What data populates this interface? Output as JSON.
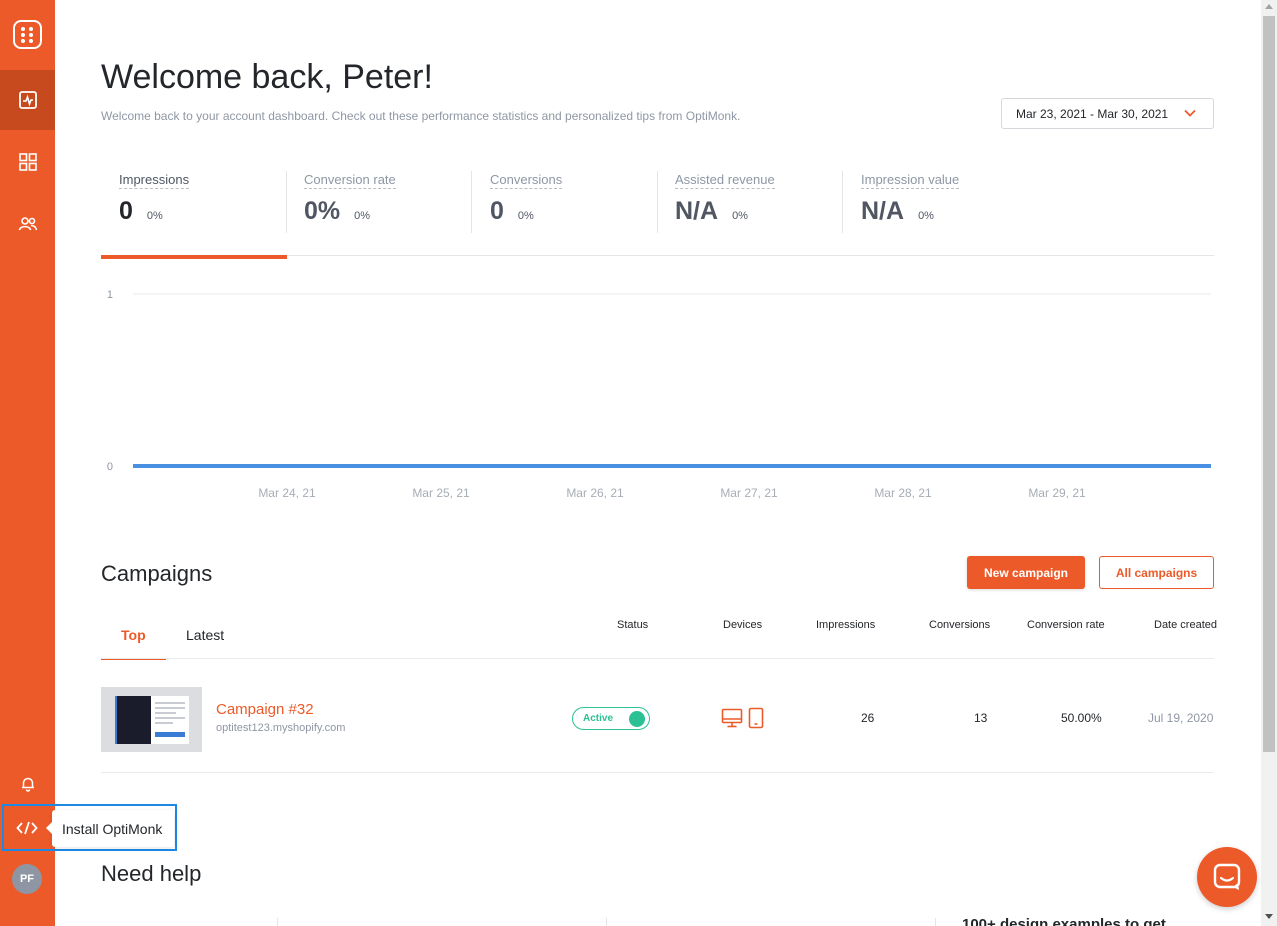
{
  "colors": {
    "accent": "#ed5a29",
    "active_status": "#2cc194",
    "chart_line": "#4a90e2",
    "highlight": "#1e88e5"
  },
  "sidebar": {
    "items": [
      {
        "icon": "pulse-chart-icon",
        "active": true
      },
      {
        "icon": "grid-icon",
        "active": false
      },
      {
        "icon": "users-icon",
        "active": false
      },
      {
        "icon": "bell-icon",
        "active": false
      },
      {
        "icon": "code-icon",
        "active": false
      }
    ],
    "avatar_initials": "PF",
    "tooltip": "Install OptiMonk"
  },
  "header": {
    "title": "Welcome back, Peter!",
    "subtitle": "Welcome back to your account dashboard. Check out these performance statistics and personalized tips from OptiMonk.",
    "date_range": "Mar 23, 2021 - Mar 30, 2021"
  },
  "stats": [
    {
      "label": "Impressions",
      "value": "0",
      "change": "0%"
    },
    {
      "label": "Conversion rate",
      "value": "0%",
      "change": "0%"
    },
    {
      "label": "Conversions",
      "value": "0",
      "change": "0%"
    },
    {
      "label": "Assisted revenue",
      "value": "N/A",
      "change": "0%"
    },
    {
      "label": "Impression value",
      "value": "N/A",
      "change": "0%"
    }
  ],
  "chart_data": {
    "type": "line",
    "x": [
      "Mar 24, 21",
      "Mar 25, 21",
      "Mar 26, 21",
      "Mar 27, 21",
      "Mar 28, 21",
      "Mar 29, 21"
    ],
    "series": [
      {
        "values": [
          0,
          0,
          0,
          0,
          0,
          0
        ]
      }
    ],
    "yticks": [
      "1",
      "0"
    ],
    "ylim": [
      0,
      1
    ],
    "grid": true
  },
  "campaigns": {
    "title": "Campaigns",
    "new_button": "New campaign",
    "all_button": "All campaigns",
    "tabs": [
      "Top",
      "Latest"
    ],
    "columns": [
      "Status",
      "Devices",
      "Impressions",
      "Conversions",
      "Conversion rate",
      "Date created"
    ],
    "rows": [
      {
        "name": "Campaign #32",
        "domain": "optitest123.myshopify.com",
        "status": "Active",
        "devices": [
          "desktop-icon",
          "mobile-icon"
        ],
        "impressions": "26",
        "conversions": "13",
        "conversion_rate": "50.00%",
        "date_created": "Jul 19, 2020"
      }
    ]
  },
  "help": {
    "title": "Need help",
    "partial_text": "100+ design examples to get"
  }
}
